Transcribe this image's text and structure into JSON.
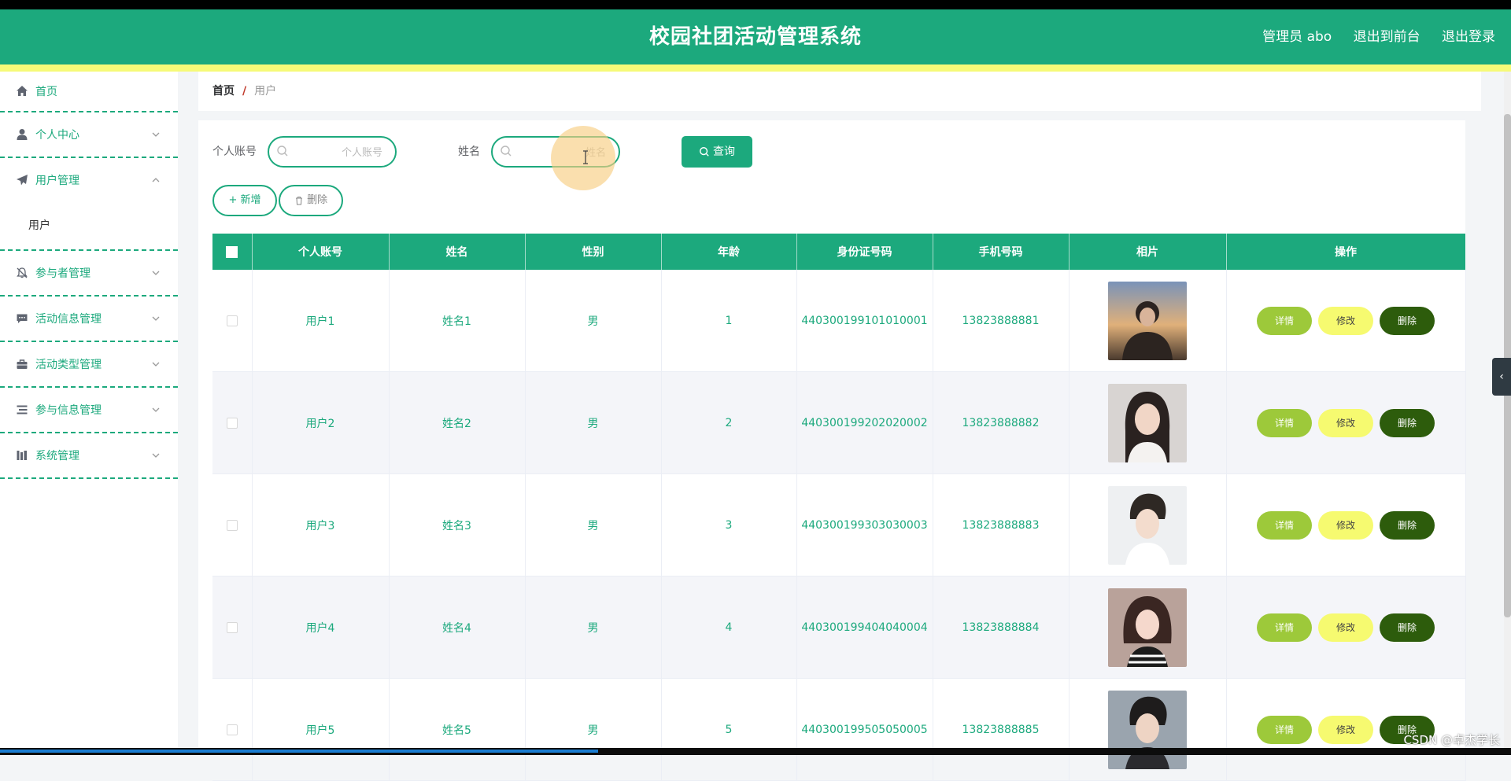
{
  "app": {
    "title": "校园社团活动管理系统",
    "user": "管理员 abo",
    "to_front": "退出到前台",
    "logout": "退出登录"
  },
  "sidebar": {
    "items": [
      {
        "label": "首页",
        "icon": "home-icon"
      },
      {
        "label": "个人中心",
        "icon": "user-icon",
        "expandable": true
      },
      {
        "label": "用户管理",
        "icon": "send-icon",
        "expanded": true,
        "children": [
          {
            "label": "用户"
          }
        ]
      },
      {
        "label": "参与者管理",
        "icon": "bell-off-icon",
        "expandable": true
      },
      {
        "label": "活动信息管理",
        "icon": "chat-icon",
        "expandable": true
      },
      {
        "label": "活动类型管理",
        "icon": "briefcase-icon",
        "expandable": true
      },
      {
        "label": "参与信息管理",
        "icon": "list-icon",
        "expandable": true
      },
      {
        "label": "系统管理",
        "icon": "chart-icon",
        "expandable": true
      }
    ]
  },
  "breadcrumb": {
    "home": "首页",
    "separator": "/",
    "current": "用户"
  },
  "search": {
    "account_label": "个人账号",
    "account_placeholder": "个人账号",
    "name_label": "姓名",
    "name_placeholder": "姓名",
    "query_label": "查询"
  },
  "actions": {
    "add_label": "+ 新增",
    "delete_label": "删除"
  },
  "table": {
    "columns": [
      "个人账号",
      "姓名",
      "性别",
      "年龄",
      "身份证号码",
      "手机号码",
      "相片",
      "操作"
    ],
    "rows": [
      {
        "account": "用户1",
        "name": "姓名1",
        "gender": "男",
        "age": "1",
        "id_card": "440300199101010001",
        "phone": "13823888881",
        "photo": "photo-1"
      },
      {
        "account": "用户2",
        "name": "姓名2",
        "gender": "男",
        "age": "2",
        "id_card": "440300199202020002",
        "phone": "13823888882",
        "photo": "photo-2"
      },
      {
        "account": "用户3",
        "name": "姓名3",
        "gender": "男",
        "age": "3",
        "id_card": "440300199303030003",
        "phone": "13823888883",
        "photo": "photo-3"
      },
      {
        "account": "用户4",
        "name": "姓名4",
        "gender": "男",
        "age": "4",
        "id_card": "440300199404040004",
        "phone": "13823888884",
        "photo": "photo-4"
      },
      {
        "account": "用户5",
        "name": "姓名5",
        "gender": "男",
        "age": "5",
        "id_card": "440300199505050005",
        "phone": "13823888885",
        "photo": "photo-5"
      }
    ],
    "op_detail": "详情",
    "op_edit": "修改",
    "op_delete": "删除"
  },
  "colors": {
    "primary": "#1ca97d",
    "accent_yellow": "#f6fa78",
    "detail": "#9dc93a",
    "edit": "#f6fa70",
    "delete": "#2d5c0c"
  },
  "watermark": "CSDN @卓杰学长"
}
